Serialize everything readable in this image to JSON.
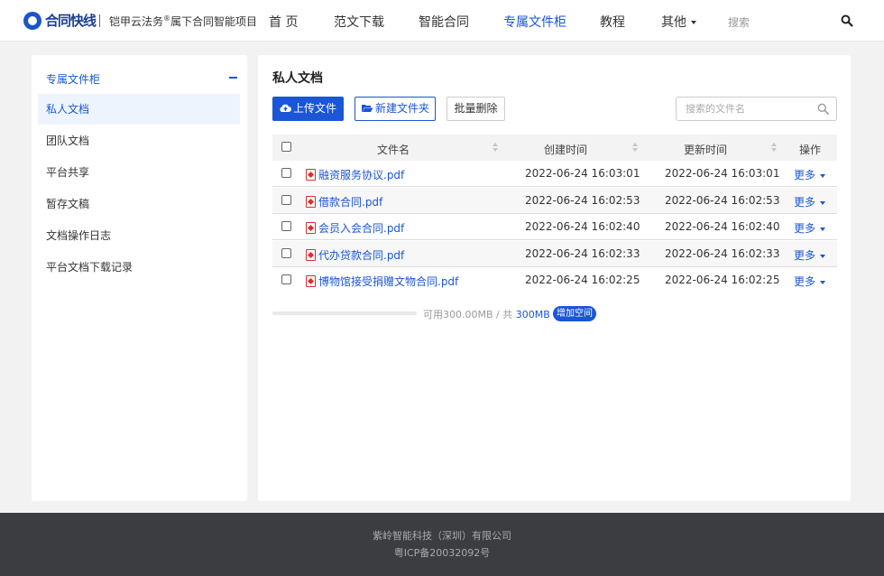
{
  "header": {
    "logo_text": "合同快线",
    "logo_subtitle_pre": "铠甲云法务",
    "logo_subtitle_reg": "®",
    "logo_subtitle_post": "属下合同智能项目",
    "nav": [
      {
        "label": "首 页",
        "active": false
      },
      {
        "label": "范文下载",
        "active": false
      },
      {
        "label": "智能合同",
        "active": false
      },
      {
        "label": "专属文件柜",
        "active": true
      },
      {
        "label": "教程",
        "active": false
      },
      {
        "label": "其他",
        "active": false
      }
    ],
    "search_label": "搜索"
  },
  "sidebar": {
    "heading": "专属文件柜",
    "items": [
      {
        "label": "私人文档",
        "active": true
      },
      {
        "label": "团队文档",
        "active": false
      },
      {
        "label": "平台共享",
        "active": false
      },
      {
        "label": "暂存文稿",
        "active": false
      },
      {
        "label": "文档操作日志",
        "active": false
      },
      {
        "label": "平台文档下载记录",
        "active": false
      }
    ]
  },
  "main": {
    "title": "私人文档",
    "toolbar": {
      "upload_label": "上传文件",
      "new_folder_label": "新建文件夹",
      "batch_delete_label": "批量删除",
      "search_placeholder": "搜索的文件名"
    },
    "table": {
      "columns": [
        "文件名",
        "创建时间",
        "更新时间",
        "操作"
      ],
      "rows": [
        {
          "name": "融资服务协议.pdf",
          "created": "2022-06-24 16:03:01",
          "updated": "2022-06-24 16:03:01",
          "action": "更多"
        },
        {
          "name": "借款合同.pdf",
          "created": "2022-06-24 16:02:53",
          "updated": "2022-06-24 16:02:53",
          "action": "更多"
        },
        {
          "name": "会员入会合同.pdf",
          "created": "2022-06-24 16:02:40",
          "updated": "2022-06-24 16:02:40",
          "action": "更多"
        },
        {
          "name": "代办贷款合同.pdf",
          "created": "2022-06-24 16:02:33",
          "updated": "2022-06-24 16:02:33",
          "action": "更多"
        },
        {
          "name": "博物馆接受捐赠文物合同.pdf",
          "created": "2022-06-24 16:02:25",
          "updated": "2022-06-24 16:02:25",
          "action": "更多"
        }
      ]
    },
    "storage": {
      "available_text": "可用300.00MB / 共",
      "total": "300MB",
      "used_fraction": 0,
      "add_space_label": "增加空间"
    }
  },
  "footer": {
    "company": "紫岭智能科技（深圳）有限公司",
    "icp": "粤ICP备20032092号"
  },
  "colors": {
    "accent": "#1a56d6",
    "footer_bg": "#3b3d41",
    "page_bg": "#f2f2f2"
  }
}
